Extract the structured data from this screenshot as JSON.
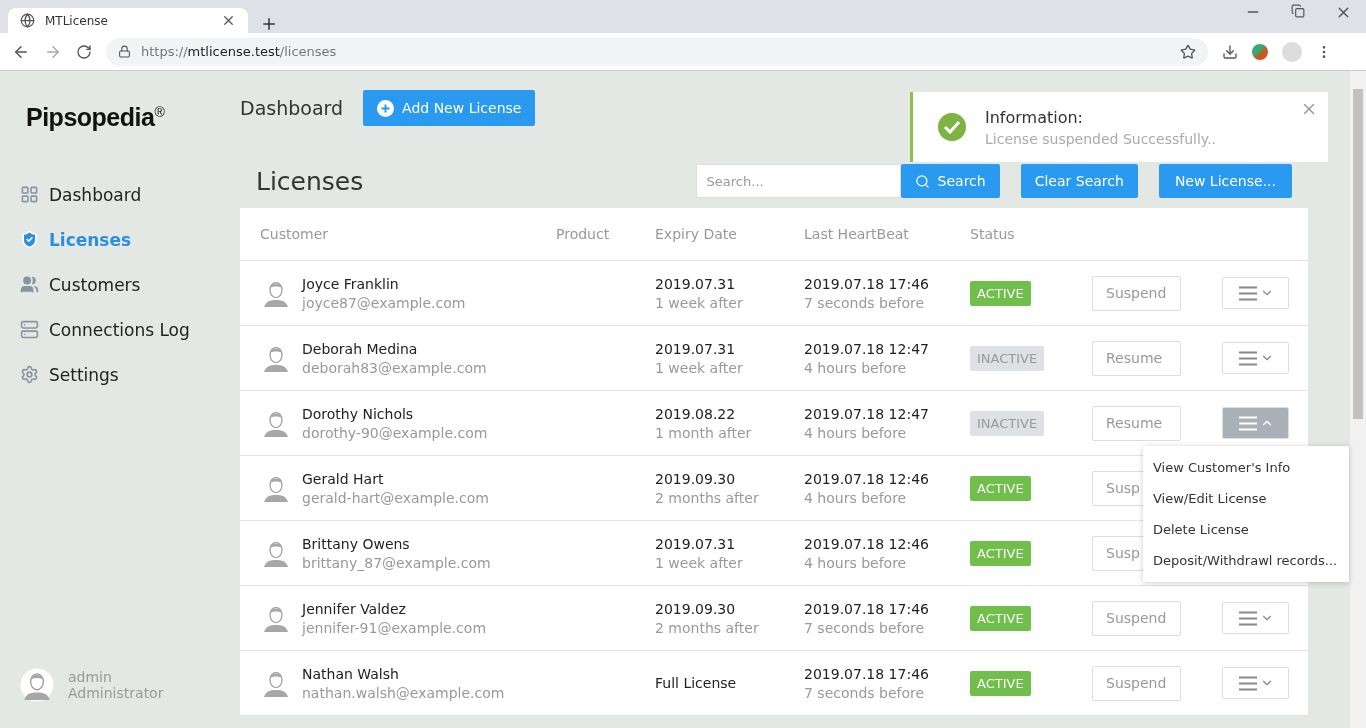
{
  "browser": {
    "tab_title": "MTLicense",
    "url_scheme": "https://",
    "url_host": "mtlicense.test",
    "url_path": "/licenses"
  },
  "brand": {
    "name": "Pipsopedia",
    "mark": "®"
  },
  "header": {
    "title": "Dashboard",
    "add_button": "Add New License"
  },
  "toast": {
    "title": "Information:",
    "message": "License suspended Successfully.."
  },
  "sidebar": {
    "items": [
      {
        "label": "Dashboard",
        "selected": false
      },
      {
        "label": "Licenses",
        "selected": true
      },
      {
        "label": "Customers",
        "selected": false
      },
      {
        "label": "Connections Log",
        "selected": false
      },
      {
        "label": "Settings",
        "selected": false
      }
    ],
    "user": {
      "name": "admin",
      "role": "Administrator"
    }
  },
  "page_title": "Licenses",
  "search": {
    "placeholder": "Search...",
    "search_button": "Search",
    "clear_button": "Clear Search",
    "new_button": "New License..."
  },
  "table": {
    "columns": [
      "Customer",
      "Product",
      "Expiry Date",
      "Last HeartBeat",
      "Status"
    ],
    "rows": [
      {
        "name": "Joyce Franklin",
        "email": "joyce87@example.com",
        "expiry": "2019.07.31",
        "expiry_rel": "1 week after",
        "heartbeat": "2019.07.18 17:46",
        "heartbeat_rel": "7 seconds before",
        "status": {
          "label": "ACTIVE",
          "active": true
        },
        "action": "Suspend",
        "menu_open": false
      },
      {
        "name": "Deborah Medina",
        "email": "deborah83@example.com",
        "expiry": "2019.07.31",
        "expiry_rel": "1 week after",
        "heartbeat": "2019.07.18 12:47",
        "heartbeat_rel": "4 hours before",
        "status": {
          "label": "INACTIVE",
          "active": false
        },
        "action": "Resume",
        "menu_open": false
      },
      {
        "name": "Dorothy Nichols",
        "email": "dorothy-90@example.com",
        "expiry": "2019.08.22",
        "expiry_rel": "1 month after",
        "heartbeat": "2019.07.18 12:47",
        "heartbeat_rel": "4 hours before",
        "status": {
          "label": "INACTIVE",
          "active": false
        },
        "action": "Resume",
        "menu_open": true,
        "menu": [
          "View Customer's Info",
          "View/Edit License",
          "Delete License",
          "Deposit/Withdrawl records..."
        ]
      },
      {
        "name": "Gerald Hart",
        "email": "gerald-hart@example.com",
        "expiry": "2019.09.30",
        "expiry_rel": "2 months after",
        "heartbeat": "2019.07.18 12:46",
        "heartbeat_rel": "4 hours before",
        "status": {
          "label": "ACTIVE",
          "active": true
        },
        "action": "Susp",
        "menu_open": false
      },
      {
        "name": "Brittany Owens",
        "email": "brittany_87@example.com",
        "expiry": "2019.07.31",
        "expiry_rel": "1 week after",
        "heartbeat": "2019.07.18 12:46",
        "heartbeat_rel": "4 hours before",
        "status": {
          "label": "ACTIVE",
          "active": true
        },
        "action": "Susp",
        "menu_open": false
      },
      {
        "name": "Jennifer Valdez",
        "email": "jennifer-91@example.com",
        "expiry": "2019.09.30",
        "expiry_rel": "2 months after",
        "heartbeat": "2019.07.18 17:46",
        "heartbeat_rel": "7 seconds before",
        "status": {
          "label": "ACTIVE",
          "active": true
        },
        "action": "Suspend",
        "menu_open": false
      },
      {
        "name": "Nathan Walsh",
        "email": "nathan.walsh@example.com",
        "expiry": "Full License",
        "heartbeat": "2019.07.18 17:46",
        "heartbeat_rel": "7 seconds before",
        "status": {
          "label": "ACTIVE",
          "active": true
        },
        "action": "Suspend",
        "menu_open": false
      }
    ]
  }
}
